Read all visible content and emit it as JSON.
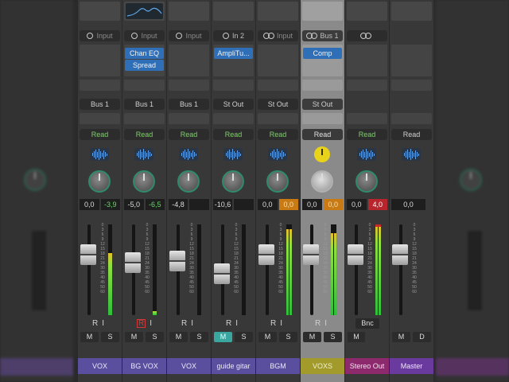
{
  "colors": {
    "accent_blue": "#2f6fb8",
    "read_green": "#7fd06a",
    "orange_value": "#c97a12",
    "red_value": "#b8252c",
    "mute_on": "#3aa6a0"
  },
  "channels": [
    {
      "name": "VOX",
      "input": "Input",
      "input_icon": "ring-icon",
      "plugins": [],
      "output": "Bus 1",
      "automation": "Read",
      "values": [
        "0,0",
        "-3,9"
      ],
      "value_styles": [
        "",
        "green"
      ],
      "fader_level": 0.72,
      "meter_level": 0.68,
      "meter_type": "single",
      "record_labels": [
        "R",
        "I"
      ],
      "buttons": [
        "M",
        "S"
      ],
      "color": "blue"
    },
    {
      "name": "BG VOX",
      "input": "Input",
      "input_icon": "ring-icon",
      "plugins": [
        "Chan EQ",
        "Spread"
      ],
      "output": "Bus 1",
      "automation": "Read",
      "values": [
        "-5,0",
        "-6,5"
      ],
      "value_styles": [
        "",
        "green"
      ],
      "fader_level": 0.6,
      "meter_level": 0.04,
      "meter_type": "single",
      "record_labels": [
        "R",
        "I"
      ],
      "record_armed": true,
      "buttons": [
        "M",
        "S"
      ],
      "color": "blue"
    },
    {
      "name": "VOX",
      "input": "Input",
      "input_icon": "ring-icon",
      "plugins": [],
      "output": "Bus 1",
      "automation": "Read",
      "values": [
        "-4,8"
      ],
      "value_styles": [
        ""
      ],
      "fader_level": 0.63,
      "meter_level": 0.0,
      "meter_type": "single",
      "record_labels": [
        "R",
        "I"
      ],
      "buttons": [
        "M",
        "S"
      ],
      "color": "blue"
    },
    {
      "name": "guide gitar",
      "input": "In 2",
      "input_icon": "ring-icon",
      "plugins": [
        "AmpliTu..."
      ],
      "output": "St Out",
      "automation": "Read",
      "values": [
        "-10,6"
      ],
      "value_styles": [
        ""
      ],
      "fader_level": 0.44,
      "meter_level": 0.0,
      "meter_type": "single",
      "record_labels": [
        "R",
        "I"
      ],
      "buttons": [
        "M",
        "S"
      ],
      "mute_on": true,
      "color": "blue"
    },
    {
      "name": "BGM",
      "input": "Input",
      "input_icon": "link-icon",
      "plugins": [],
      "output": "St Out",
      "automation": "Read",
      "values": [
        "0,0",
        "0,0"
      ],
      "value_styles": [
        "",
        "orange"
      ],
      "fader_level": 0.72,
      "meter_level": 0.95,
      "meter_type": "dual",
      "record_labels": [
        "R",
        "I"
      ],
      "buttons": [
        "M",
        "S"
      ],
      "color": "blue"
    },
    {
      "name": "VOXS",
      "input": "Bus 1",
      "input_icon": "link-icon",
      "plugins": [
        "Comp"
      ],
      "output": "St Out",
      "automation": "Read",
      "values": [
        "0,0",
        "0,0"
      ],
      "value_styles": [
        "",
        "orange"
      ],
      "fader_level": 0.72,
      "meter_level": 0.9,
      "meter_type": "dual",
      "record_labels": [
        "R",
        "I"
      ],
      "buttons": [
        "M",
        "S"
      ],
      "color": "yellow",
      "selected": true,
      "tuner": true
    },
    {
      "name": "Stereo Out",
      "input": "",
      "input_icon": "link-icon",
      "plugins": [],
      "output": "",
      "automation": "Read",
      "values": [
        "0,0",
        "4,0"
      ],
      "value_styles": [
        "",
        "red"
      ],
      "fader_level": 0.72,
      "meter_level": 0.98,
      "meter_type": "dual",
      "clip": true,
      "record_labels": [],
      "bounce": "Bnc",
      "buttons": [
        "M"
      ],
      "color": "magenta"
    },
    {
      "name": "Master",
      "input": "",
      "input_icon": "",
      "plugins": [],
      "output": "",
      "automation": "Read",
      "automation_plain": true,
      "values": [
        "0,0"
      ],
      "value_styles": [
        ""
      ],
      "fader_level": 0.72,
      "meter_level": 0.0,
      "meter_type": "none",
      "record_labels": [],
      "buttons": [
        "M",
        "D"
      ],
      "color": "purple"
    }
  ]
}
